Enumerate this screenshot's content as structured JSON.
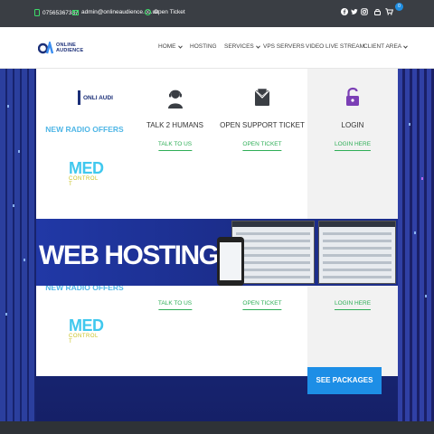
{
  "topbar": {
    "phone": "07565367387",
    "email": "admin@onlineaudience.co.uk",
    "ticket": "Open Ticket",
    "cart_count": "0"
  },
  "logo": {
    "line1": "ONLINE",
    "line2": "AUDIENCE"
  },
  "nav": {
    "items": [
      {
        "label": "HOME",
        "dropdown": true
      },
      {
        "label": "HOSTING",
        "dropdown": false
      },
      {
        "label": "SERVICES",
        "dropdown": true
      },
      {
        "label": "VPS SERVERS",
        "dropdown": false
      },
      {
        "label": "VIDEO LIVE STREAM",
        "dropdown": false
      },
      {
        "label": "CLIENT AREA",
        "dropdown": true
      }
    ]
  },
  "cards": {
    "radio": {
      "title": "NEW RADIO OFFERS",
      "logo_text": "ONLI AUDI"
    },
    "media": {
      "big": "MED",
      "small": "CONTROL T"
    },
    "talk": {
      "title": "TALK 2 HUMANS",
      "link": "TALK TO US"
    },
    "support": {
      "title": "OPEN SUPPORT TICKET",
      "link": "OPEN TICKET"
    },
    "login": {
      "title": "LOGIN",
      "link": "LOGIN HERE"
    }
  },
  "band": {
    "title": "WEB HOSTING"
  },
  "lower_cards": {
    "radio": {
      "title": "NEW RADIO OFFERS"
    },
    "media": {
      "big": "MED",
      "small": "CONTROL T"
    },
    "talk": {
      "link": "TALK TO US"
    },
    "support": {
      "link": "OPEN TICKET"
    },
    "login": {
      "link": "LOGIN HERE"
    }
  },
  "hero": {
    "button": "SEE PACKAGES"
  },
  "colors": {
    "accent_blue": "#1d8ee6",
    "link_green": "#2fae57",
    "heading_blue": "#4fb6e6",
    "login_purple": "#7b3fb5",
    "topbar_bg": "#3a3e44"
  },
  "icons": {
    "phone": "phone-icon",
    "email": "envelope-icon",
    "ticket": "whatsapp-icon",
    "facebook": "facebook-icon",
    "twitter": "twitter-icon",
    "instagram": "instagram-icon",
    "login": "lock-icon",
    "cart": "cart-icon",
    "talk": "headset-person-icon",
    "support": "ticket-envelope-icon",
    "login_card": "padlock-icon"
  }
}
